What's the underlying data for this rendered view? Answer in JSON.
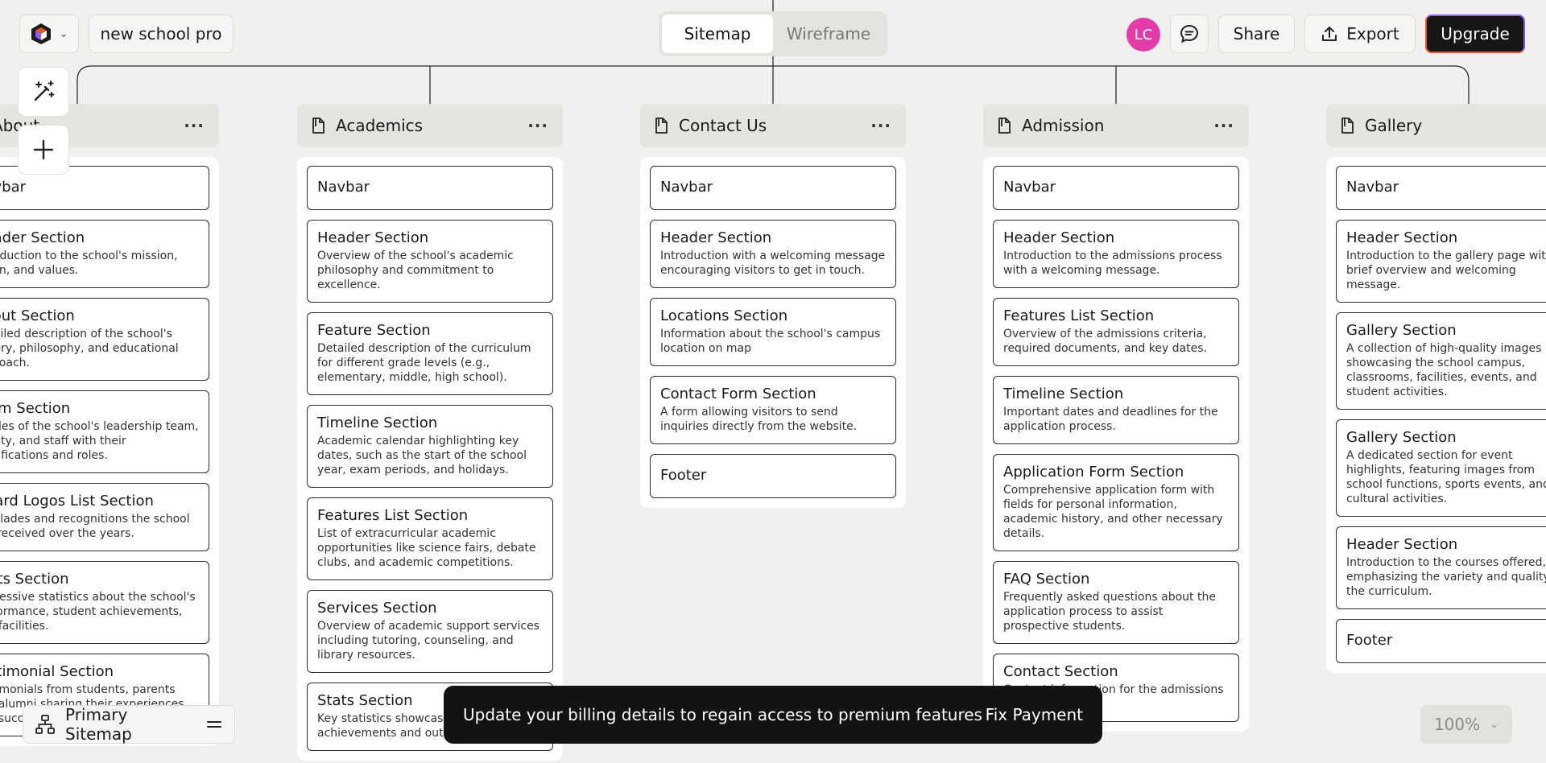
{
  "header": {
    "project_name": "new school pro",
    "view_toggle": {
      "sitemap": "Sitemap",
      "wireframe": "Wireframe",
      "active": "Sitemap"
    },
    "avatar_initials": "LC",
    "share": "Share",
    "export": "Export",
    "upgrade": "Upgrade"
  },
  "columns": [
    {
      "title": "About",
      "cards": [
        {
          "title": "Navbar",
          "desc": ""
        },
        {
          "title": "Header Section",
          "desc": "Introduction to the school's mission, vision, and values."
        },
        {
          "title": "About Section",
          "desc": "Detailed description of the school's history, philosophy, and educational approach."
        },
        {
          "title": "Team Section",
          "desc": "Profiles of the school's leadership team, faculty, and staff with their qualifications and roles."
        },
        {
          "title": "Award Logos List Section",
          "desc": "Accolades and recognitions the school has received over the years."
        },
        {
          "title": "Stats Section",
          "desc": "Impressive statistics about the school's performance, student achievements, and facilities."
        },
        {
          "title": "Testimonial Section",
          "desc": "Testimonials from students, parents and alumni sharing their experiences and success stories."
        }
      ]
    },
    {
      "title": "Academics",
      "cards": [
        {
          "title": "Navbar",
          "desc": ""
        },
        {
          "title": "Header Section",
          "desc": "Overview of the school's academic philosophy and commitment to excellence."
        },
        {
          "title": "Feature Section",
          "desc": "Detailed description of the curriculum for different grade levels (e.g., elementary, middle, high school)."
        },
        {
          "title": "Timeline Section",
          "desc": "Academic calendar highlighting key dates, such as the start of the school year, exam periods, and holidays."
        },
        {
          "title": "Features List Section",
          "desc": "List of extracurricular academic opportunities like science fairs, debate clubs, and academic competitions."
        },
        {
          "title": "Services Section",
          "desc": "Overview of academic support services including tutoring, counseling, and library resources."
        },
        {
          "title": "Stats Section",
          "desc": "Key statistics showcasing academic achievements and outcomes."
        }
      ]
    },
    {
      "title": "Contact Us",
      "cards": [
        {
          "title": "Navbar",
          "desc": ""
        },
        {
          "title": "Header Section",
          "desc": "Introduction with a welcoming message encouraging visitors to get in touch."
        },
        {
          "title": "Locations Section",
          "desc": "Information about the school's campus location on map"
        },
        {
          "title": "Contact Form Section",
          "desc": "A form allowing visitors to send inquiries directly from the website."
        },
        {
          "title": "Footer",
          "desc": ""
        }
      ]
    },
    {
      "title": "Admission",
      "cards": [
        {
          "title": "Navbar",
          "desc": ""
        },
        {
          "title": "Header Section",
          "desc": "Introduction to the admissions process with a welcoming message."
        },
        {
          "title": "Features List Section",
          "desc": "Overview of the admissions criteria, required documents, and key dates."
        },
        {
          "title": "Timeline Section",
          "desc": "Important dates and deadlines for the application process."
        },
        {
          "title": "Application Form Section",
          "desc": "Comprehensive application form with fields for personal information, academic history, and other necessary details."
        },
        {
          "title": "FAQ Section",
          "desc": "Frequently asked questions about the application process to assist prospective students."
        },
        {
          "title": "Contact Section",
          "desc": "Contact information for the admissions office."
        }
      ]
    },
    {
      "title": "Gallery",
      "cards": [
        {
          "title": "Navbar",
          "desc": ""
        },
        {
          "title": "Header Section",
          "desc": "Introduction to the gallery page with a brief overview and welcoming message."
        },
        {
          "title": "Gallery Section",
          "desc": "A collection of high-quality images showcasing the school campus, classrooms, facilities, events, and student activities."
        },
        {
          "title": "Gallery Section",
          "desc": "A dedicated section for event highlights, featuring images from school functions, sports events, and cultural activities."
        },
        {
          "title": "Header Section",
          "desc": "Introduction to the courses offered, emphasizing the variety and quality of the curriculum."
        },
        {
          "title": "Footer",
          "desc": ""
        }
      ]
    }
  ],
  "bottom": {
    "sitemap_name": "Primary Sitemap",
    "toast_message": "Update your billing details to regain access to premium features",
    "toast_action": "Fix Payment",
    "zoom": "100%"
  },
  "icons": {
    "logo": "cube-logo-icon",
    "ai_tool": "magic-wand-icon",
    "add_tool": "plus-icon",
    "comment": "comment-icon",
    "export": "upload-icon",
    "sitemap": "sitemap-icon",
    "menu": "menu-icon",
    "page": "page-icon"
  },
  "colors": {
    "avatar": "#e23ca8",
    "toast_bg": "#131313",
    "upgrade_bg": "#161616"
  }
}
